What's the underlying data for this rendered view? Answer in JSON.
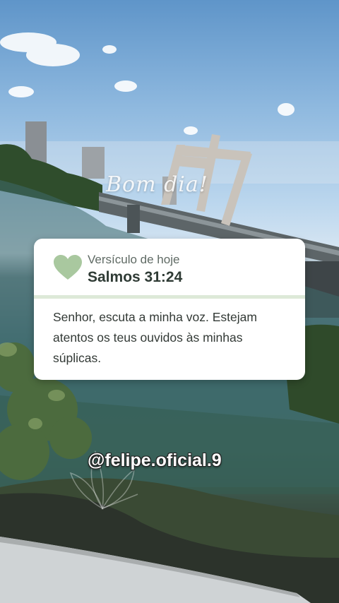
{
  "overlay": {
    "greeting": "Bom dia!",
    "handle": "@felipe.oficial.9"
  },
  "verse_card": {
    "subtitle": "Versículo de hoje",
    "reference": "Salmos 31:24",
    "text": "Senhor, escuta a minha voz. Estejam atentos os teus ouvidos às minhas súplicas.",
    "icon": "heart-icon",
    "accent_color": "#a9c89f"
  },
  "scene": {
    "description_colors": {
      "sky": "#8fb9df",
      "water": "#3d6a70",
      "vegetation": "#4c6b3e"
    }
  }
}
